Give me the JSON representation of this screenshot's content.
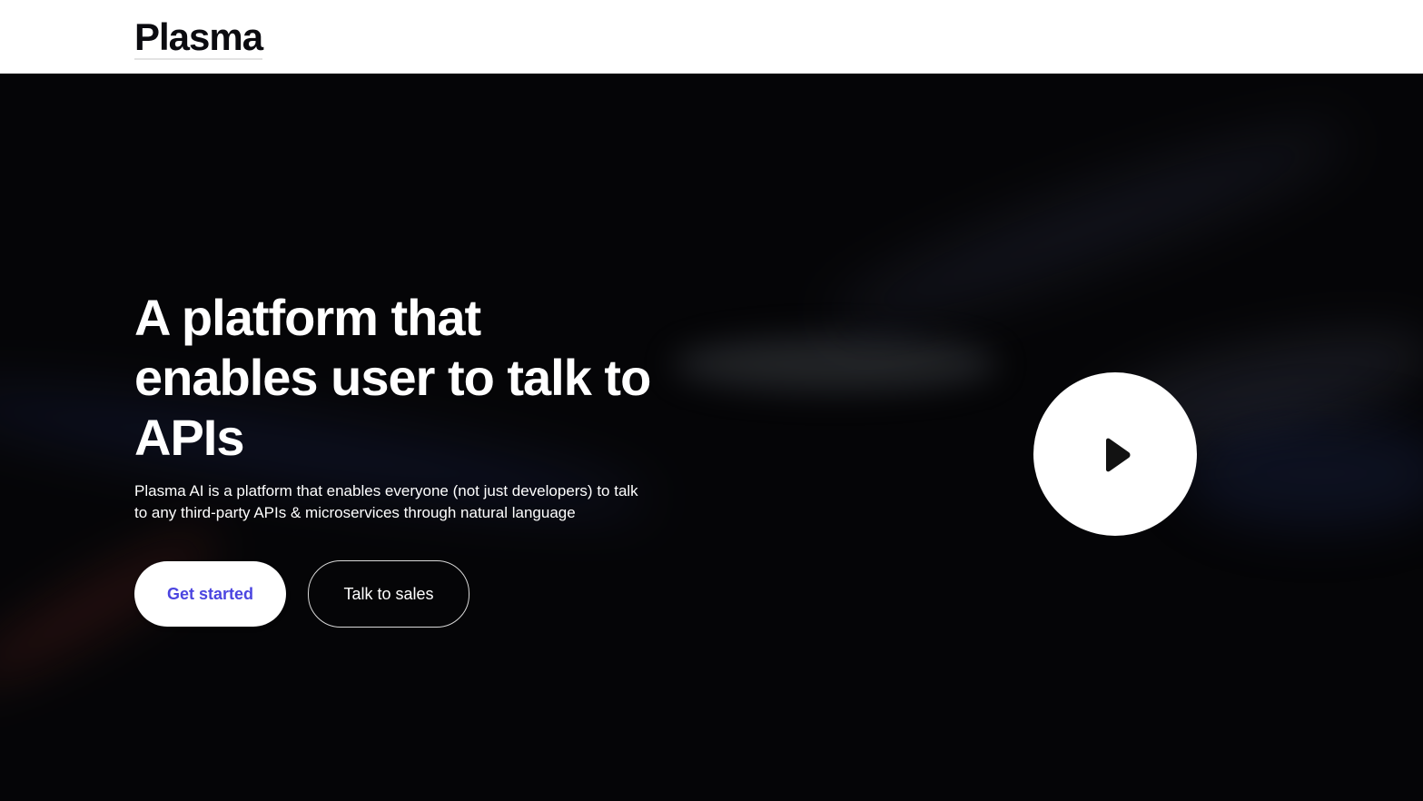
{
  "header": {
    "logo_text": "Plasma"
  },
  "hero": {
    "headline": "A platform that enables user to talk to APIs",
    "description": "Plasma AI is a platform that enables everyone (not just developers) to talk to any third-party APIs & microservices through natural language",
    "primary_button_label": "Get started",
    "secondary_button_label": "Talk to sales",
    "video_icon": "play-icon"
  },
  "colors": {
    "header_bg": "#ffffff",
    "hero_bg": "#050507",
    "accent": "#4b45e0",
    "text_light": "#ffffff"
  }
}
